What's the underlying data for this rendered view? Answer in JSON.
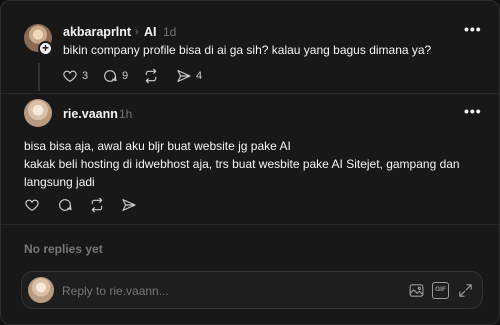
{
  "post": {
    "username": "akbaraprlnt",
    "tag": "AI",
    "time": "1d",
    "text": "bikin company profile bisa di ai ga sih? kalau yang bagus dimana ya?",
    "likes": "3",
    "comments": "9",
    "shares": "4"
  },
  "reply": {
    "username": "rie.vaann",
    "time": "1h",
    "lines": [
      "bisa bisa aja, awal aku bljr buat website jg pake AI",
      "kakak beli hosting di idwebhost aja, trs buat wesbite pake AI Sitejet, gampang dan",
      "langsung jadi"
    ]
  },
  "no_replies": "No replies yet",
  "composer": {
    "placeholder": "Reply to rie.vaann...",
    "gif_label": "GIF"
  },
  "icons": {
    "like": "heart-icon",
    "comment": "comment-icon",
    "repost": "repost-icon",
    "share": "share-icon",
    "more": "more-icon",
    "image": "image-icon",
    "gif": "gif-icon",
    "expand": "expand-icon"
  }
}
